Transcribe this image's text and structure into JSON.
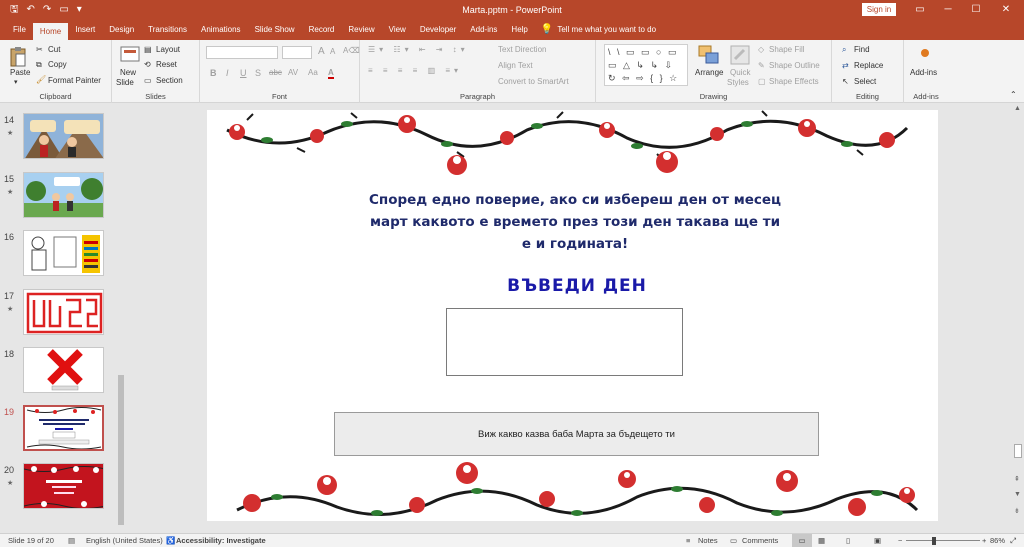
{
  "window": {
    "title": "Marta.pptm  -  PowerPoint",
    "sign_in": "Sign in",
    "min": "─",
    "max": "☐",
    "close": "✕",
    "restore": "▭"
  },
  "qat": {
    "save": "🖫",
    "undo": "↶",
    "redo": "↷",
    "present": "▭",
    "more": "▾"
  },
  "tabs": [
    "File",
    "Home",
    "Insert",
    "Design",
    "Transitions",
    "Animations",
    "Slide Show",
    "Record",
    "Review",
    "View",
    "Developer",
    "Add-ins",
    "Help"
  ],
  "tell_me": "Tell me what you want to do",
  "ribbon": {
    "clipboard": {
      "label": "Clipboard",
      "paste": "Paste",
      "cut": "Cut",
      "copy": "Copy",
      "format_painter": "Format Painter"
    },
    "slides": {
      "label": "Slides",
      "new_slide": "New",
      "new_slide2": "Slide",
      "layout": "Layout",
      "reset": "Reset",
      "section": "Section"
    },
    "font": {
      "label": "Font",
      "bold": "B",
      "italic": "I",
      "underline": "U",
      "strike": "S",
      "abc": "abc",
      "av": "AV",
      "aa": "Aa",
      "fontcolor": "A"
    },
    "paragraph": {
      "label": "Paragraph",
      "text_direction": "Text Direction",
      "align_text": "Align Text",
      "smartart": "Convert to SmartArt"
    },
    "drawing": {
      "label": "Drawing",
      "arrange": "Arrange",
      "quick_styles": "Quick",
      "quick_styles2": "Styles",
      "shape_fill": "Shape Fill",
      "shape_outline": "Shape Outline",
      "shape_effects": "Shape Effects",
      "shapes": "\\ \\ ▭ ▭ ○ ▭ ▭ △ ↳ ↳ ⇩ ↻ ⇦ ⇨ { } ☆ ⌒ ↩ ∿ ⊢ ⊣ ⊥"
    },
    "editing": {
      "label": "Editing",
      "find": "Find",
      "replace": "Replace",
      "select": "Select"
    },
    "addins": {
      "label": "Add-ins",
      "addins": "Add-ins"
    }
  },
  "thumbnails": [
    {
      "num": "14",
      "star": "★"
    },
    {
      "num": "15",
      "star": "★"
    },
    {
      "num": "16",
      "star": ""
    },
    {
      "num": "17",
      "star": "★"
    },
    {
      "num": "18",
      "star": ""
    },
    {
      "num": "19",
      "star": ""
    },
    {
      "num": "20",
      "star": "★"
    }
  ],
  "slide": {
    "text": "Според едно поверие, ако си избереш ден от месец март каквото е времето през този ден такава ще ти е и годината!",
    "enter_day": "ВЪВЕДИ ДЕН",
    "button": "Виж какво казва баба Марта за бъдещето ти"
  },
  "status": {
    "slide_of": "Slide 19 of 20",
    "language": "English (United States)",
    "accessibility": "Accessibility: Investigate",
    "notes": "Notes",
    "comments": "Comments",
    "zoom": "86%",
    "minus": "−",
    "plus": "+"
  },
  "colors": {
    "accent": "#b7472a",
    "slide_text": "#1f2a6b",
    "enter_day": "#1a1aa8"
  }
}
